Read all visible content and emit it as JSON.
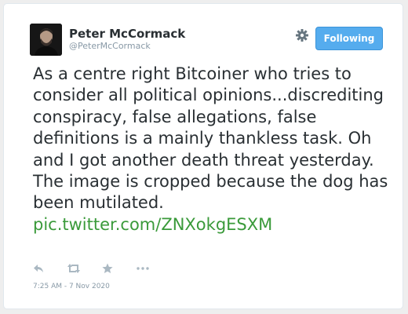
{
  "author": {
    "display_name": "Peter McCormack",
    "handle": "@PeterMcCormack"
  },
  "header": {
    "follow_button_label": "Following",
    "settings_icon": "gear-icon"
  },
  "tweet": {
    "text": "As a centre right Bitcoiner who tries to consider all political opinions...discrediting conspiracy, false allegations, false definitions is a mainly thankless task. Oh and I got another death threat yesterday. The image is cropped because the dog has been mutilated.",
    "link": "pic.twitter.com/ZNXokgESXM",
    "timestamp": "7:25 AM - 7 Nov 2020"
  },
  "actions": [
    {
      "icon": "reply-icon"
    },
    {
      "icon": "retweet-icon"
    },
    {
      "icon": "favorite-star-icon"
    },
    {
      "icon": "more-dots-icon"
    }
  ],
  "colors": {
    "follow_button_bg": "#55acee",
    "link": "#3a9a3a",
    "text": "#292f33",
    "muted": "#8899a6"
  }
}
